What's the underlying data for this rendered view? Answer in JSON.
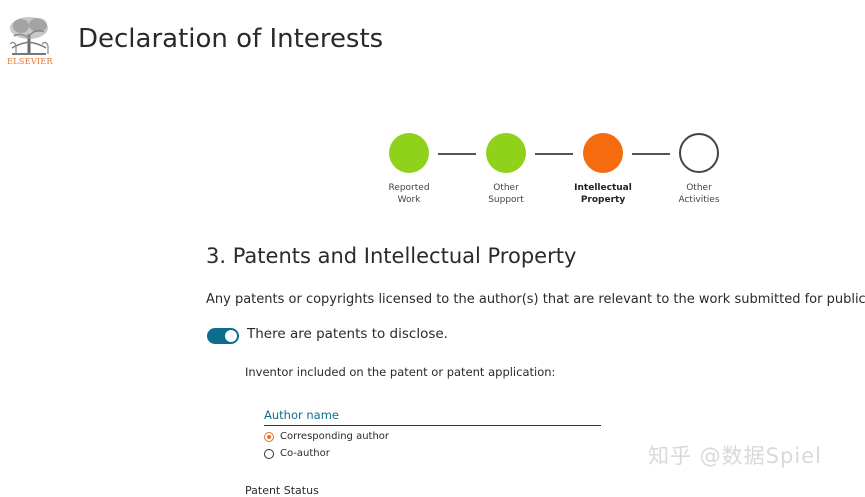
{
  "header": {
    "logo_text": "ELSEVIER",
    "title": "Declaration of Interests"
  },
  "stepper": {
    "steps": [
      {
        "line1": "Reported",
        "line2": "Work",
        "state": "complete",
        "color": "#8fd11b"
      },
      {
        "line1": "Other",
        "line2": "Support",
        "state": "complete",
        "color": "#8fd11b"
      },
      {
        "line1": "Intellectual",
        "line2": "Property",
        "state": "current",
        "color": "#f76b0f"
      },
      {
        "line1": "Other",
        "line2": "Activities",
        "state": "pending",
        "color": "#ffffff"
      }
    ]
  },
  "section": {
    "title": "3. Patents and Intellectual Property",
    "question": "Any patents or copyrights licensed to the author(s) that are relevant to the work submitted for publication.",
    "toggle_on": true,
    "toggle_label": "There are patents to disclose.",
    "inventor_label": "Inventor included on the patent or patent application:",
    "author_field_label": "Author name",
    "radio_options": [
      {
        "label": "Corresponding author",
        "checked": true
      },
      {
        "label": "Co-author",
        "checked": false
      }
    ],
    "cutoff_text": "Patent Status"
  },
  "watermark": "知乎 @数据Spiel",
  "colors": {
    "brand_orange": "#e9711c",
    "accent_teal": "#0c6e8f",
    "complete_green": "#8fd11b",
    "current_orange": "#f76b0f"
  }
}
